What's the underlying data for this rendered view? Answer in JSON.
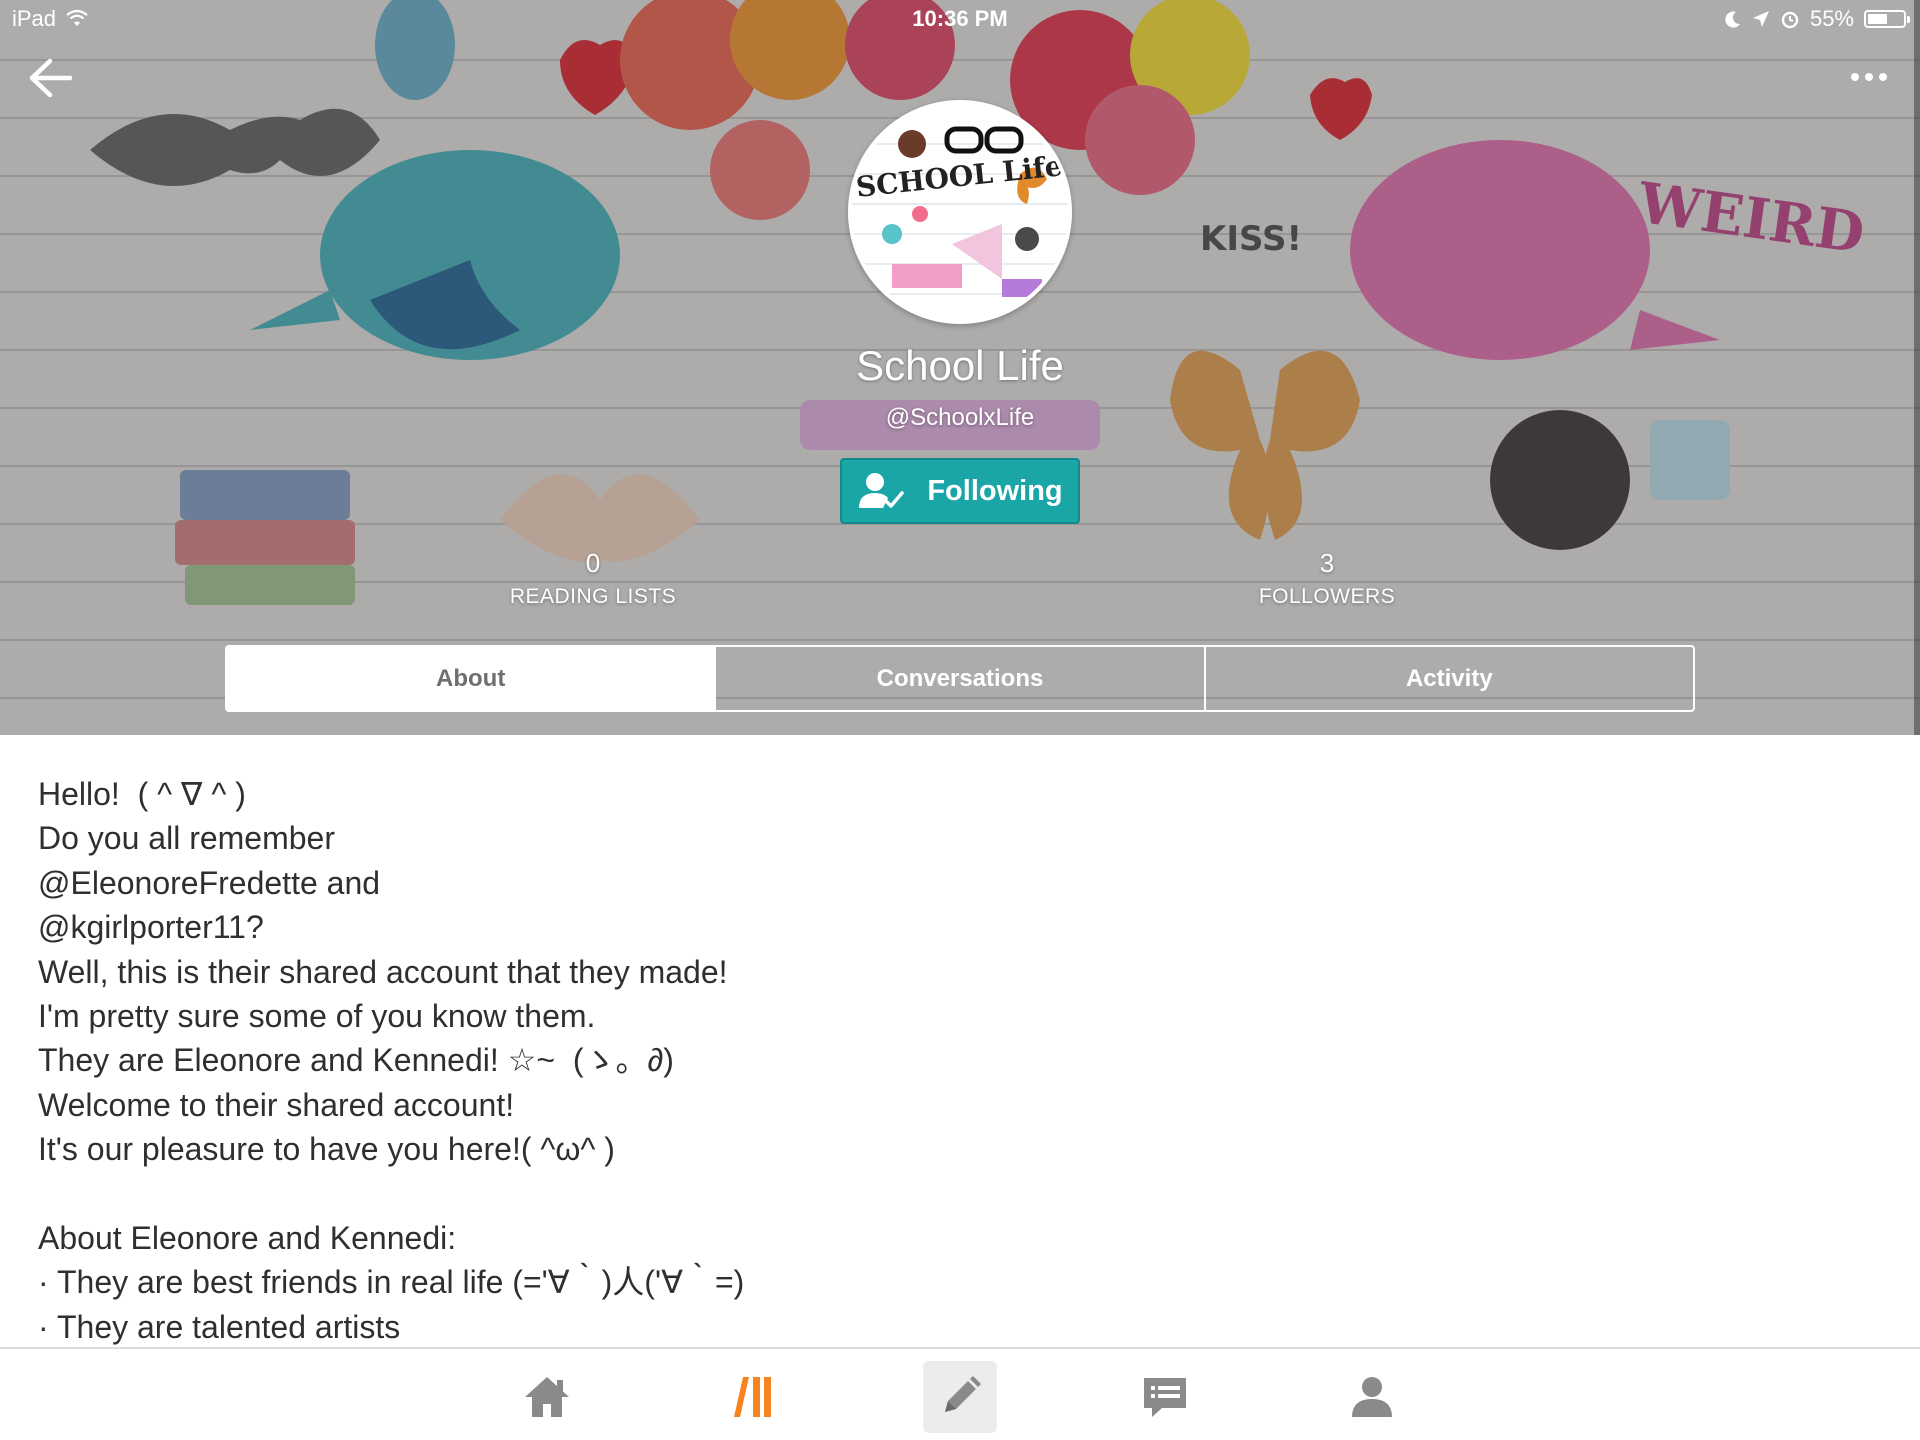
{
  "status_bar": {
    "device": "iPad",
    "time": "10:36 PM",
    "battery_text": "55%",
    "battery_level": 0.55
  },
  "profile": {
    "name": "School Life",
    "handle": "@SchoolxLife",
    "follow_label": "Following",
    "avatar_text": "SCHOOL Life"
  },
  "stats": [
    {
      "value": "0",
      "label": "READING LISTS"
    },
    {
      "value": "3",
      "label": "FOLLOWERS"
    }
  ],
  "tabs": [
    {
      "label": "About",
      "active": true
    },
    {
      "label": "Conversations",
      "active": false
    },
    {
      "label": "Activity",
      "active": false
    }
  ],
  "about_lines": [
    "Hello!  ( ^ ∇ ^ )",
    "Do you all remember",
    "@EleonoreFredette and",
    "@kgirlporter11?",
    "Well, this is their shared account that they made!",
    "I'm pretty sure some of you know them.",
    "They are Eleonore and Kennedi! ☆~  (ゝ。∂)",
    "Welcome to their shared account!",
    "It's our pleasure to have you here!( ^ω^ )",
    "",
    "About Eleonore and Kennedi:",
    "· They are best friends in real life (='∀｀)人('∀｀=)",
    "· They are talented artists"
  ],
  "bottom_nav": [
    "home-icon",
    "library-icon",
    "write-icon",
    "messages-icon",
    "profile-icon"
  ],
  "colors": {
    "accent": "#1aa6a6",
    "library_accent": "#f7841e",
    "icon_gray": "#8a8a8a",
    "text": "#2f2f2f"
  }
}
